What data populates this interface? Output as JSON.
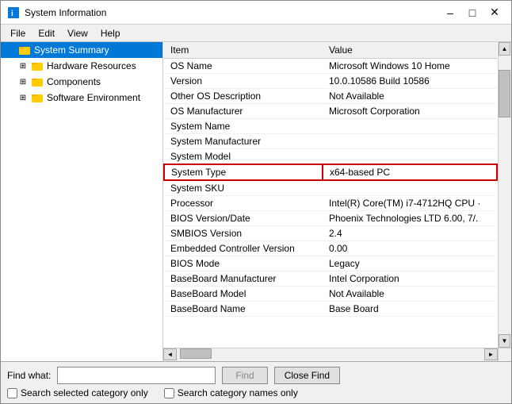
{
  "window": {
    "title": "System Information",
    "icon": "info-icon"
  },
  "menu": {
    "items": [
      "File",
      "Edit",
      "View",
      "Help"
    ]
  },
  "sidebar": {
    "items": [
      {
        "id": "system-summary",
        "label": "System Summary",
        "level": 0,
        "selected": true,
        "expandable": false
      },
      {
        "id": "hardware-resources",
        "label": "Hardware Resources",
        "level": 1,
        "selected": false,
        "expandable": true
      },
      {
        "id": "components",
        "label": "Components",
        "level": 1,
        "selected": false,
        "expandable": true
      },
      {
        "id": "software-environment",
        "label": "Software Environment",
        "level": 1,
        "selected": false,
        "expandable": true
      }
    ]
  },
  "table": {
    "columns": [
      "Item",
      "Value"
    ],
    "rows": [
      {
        "item": "OS Name",
        "value": "Microsoft Windows 10 Home",
        "highlighted": false
      },
      {
        "item": "Version",
        "value": "10.0.10586 Build 10586",
        "highlighted": false
      },
      {
        "item": "Other OS Description",
        "value": "Not Available",
        "highlighted": false
      },
      {
        "item": "OS Manufacturer",
        "value": "Microsoft Corporation",
        "highlighted": false
      },
      {
        "item": "System Name",
        "value": "",
        "highlighted": false
      },
      {
        "item": "System Manufacturer",
        "value": "",
        "highlighted": false
      },
      {
        "item": "System Model",
        "value": "",
        "highlighted": false
      },
      {
        "item": "System Type",
        "value": "x64-based PC",
        "highlighted": true
      },
      {
        "item": "System SKU",
        "value": "",
        "highlighted": false
      },
      {
        "item": "Processor",
        "value": "Intel(R) Core(TM) i7-4712HQ CPU ·",
        "highlighted": false
      },
      {
        "item": "BIOS Version/Date",
        "value": "Phoenix Technologies LTD 6.00, 7/.",
        "highlighted": false
      },
      {
        "item": "SMBIOS Version",
        "value": "2.4",
        "highlighted": false
      },
      {
        "item": "Embedded Controller Version",
        "value": "0.00",
        "highlighted": false
      },
      {
        "item": "BIOS Mode",
        "value": "Legacy",
        "highlighted": false
      },
      {
        "item": "BaseBoard Manufacturer",
        "value": "Intel Corporation",
        "highlighted": false
      },
      {
        "item": "BaseBoard Model",
        "value": "Not Available",
        "highlighted": false
      },
      {
        "item": "BaseBoard Name",
        "value": "Base Board",
        "highlighted": false
      }
    ]
  },
  "find_bar": {
    "label": "Find what:",
    "placeholder": "",
    "find_button": "Find",
    "close_button": "Close Find",
    "checkbox1": "Search selected category only",
    "checkbox2": "Search category names only"
  },
  "scrollbar": {
    "up_arrow": "▲",
    "down_arrow": "▼",
    "left_arrow": "◄",
    "right_arrow": "►"
  }
}
